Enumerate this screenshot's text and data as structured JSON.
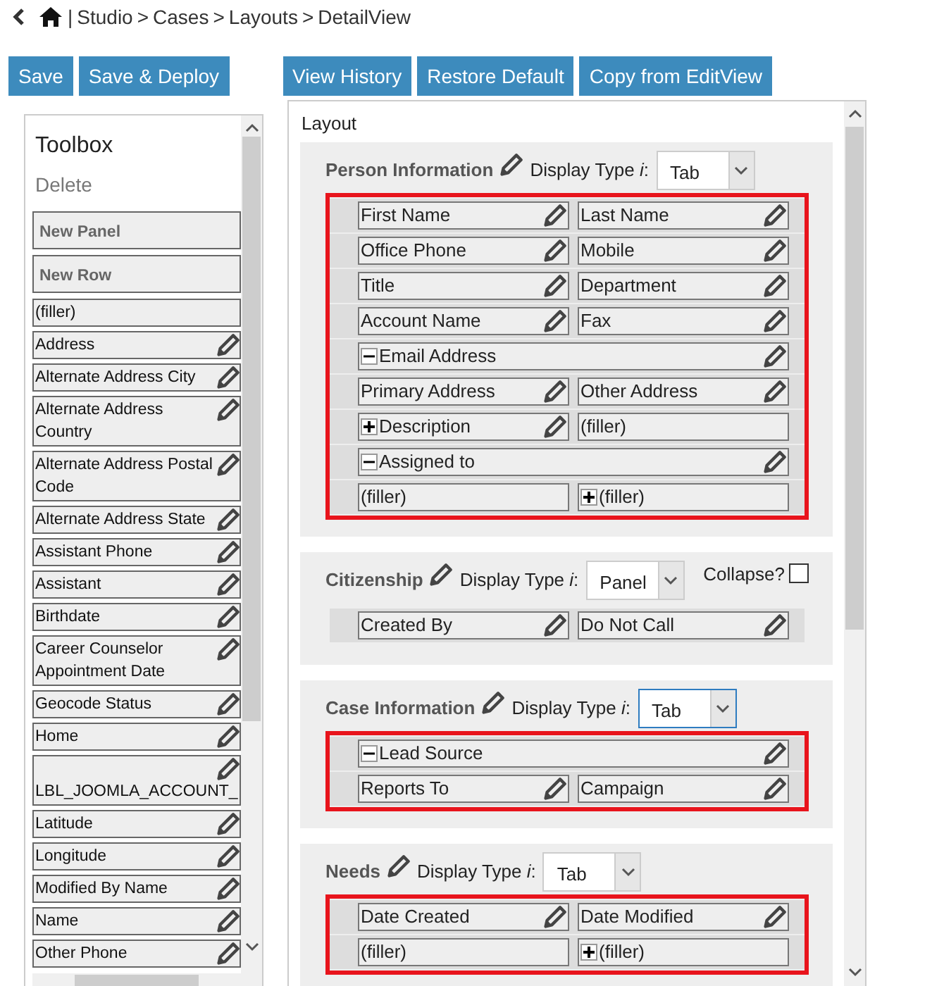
{
  "breadcrumb": {
    "divider": "|",
    "separator": ">",
    "items": [
      "Studio",
      "Cases",
      "Layouts",
      "DetailView"
    ]
  },
  "toolbar_left": [
    "Save",
    "Save & Deploy"
  ],
  "toolbar_right": [
    "View History",
    "Restore Default",
    "Copy from EditView"
  ],
  "toolbox": {
    "title": "Toolbox",
    "delete_label": "Delete",
    "items": [
      {
        "kind": "new",
        "label": "New Panel"
      },
      {
        "kind": "new",
        "label": "New Row"
      },
      {
        "kind": "field",
        "label": "(filler)",
        "editable": false
      },
      {
        "kind": "field",
        "label": "Address",
        "editable": true
      },
      {
        "kind": "field",
        "label": "Alternate Address City",
        "editable": true
      },
      {
        "kind": "field",
        "label": "Alternate Address Country",
        "editable": true
      },
      {
        "kind": "field",
        "label": "Alternate Address Postal Code",
        "editable": true
      },
      {
        "kind": "field",
        "label": "Alternate Address State",
        "editable": true
      },
      {
        "kind": "field",
        "label": "Assistant Phone",
        "editable": true
      },
      {
        "kind": "field",
        "label": "Assistant",
        "editable": true
      },
      {
        "kind": "field",
        "label": "Birthdate",
        "editable": true
      },
      {
        "kind": "field",
        "label": "Career Counselor Appointment Date",
        "editable": true
      },
      {
        "kind": "field",
        "label": "Geocode Status",
        "editable": true
      },
      {
        "kind": "field",
        "label": "Home",
        "editable": true
      },
      {
        "kind": "field",
        "label": "LBL_JOOMLA_ACCOUNT_",
        "editable": true
      },
      {
        "kind": "field",
        "label": "Latitude",
        "editable": true
      },
      {
        "kind": "field",
        "label": "Longitude",
        "editable": true
      },
      {
        "kind": "field",
        "label": "Modified By Name",
        "editable": true
      },
      {
        "kind": "field",
        "label": "Name",
        "editable": true
      },
      {
        "kind": "field",
        "label": "Other Phone",
        "editable": true
      }
    ]
  },
  "layout": {
    "title": "Layout",
    "panels": [
      {
        "title": "Person Information",
        "display_label": "Display Type *i*:",
        "display_type": "Tab",
        "select_focused": false,
        "highlighted": true,
        "rows": [
          {
            "cells": [
              {
                "label": "First Name",
                "editable": true
              },
              {
                "label": "Last Name",
                "editable": true
              }
            ]
          },
          {
            "cells": [
              {
                "label": "Office Phone",
                "editable": true
              },
              {
                "label": "Mobile",
                "editable": true
              }
            ]
          },
          {
            "cells": [
              {
                "label": "Title",
                "editable": true
              },
              {
                "label": "Department",
                "editable": true
              }
            ]
          },
          {
            "cells": [
              {
                "label": "Account Name",
                "editable": true
              },
              {
                "label": "Fax",
                "editable": true
              }
            ]
          },
          {
            "cells": [
              {
                "label": "Email Address",
                "editable": true,
                "expanded": true
              }
            ]
          },
          {
            "cells": [
              {
                "label": "Primary Address",
                "editable": true
              },
              {
                "label": "Other Address",
                "editable": true
              }
            ]
          },
          {
            "cells": [
              {
                "label": "Description",
                "editable": true,
                "expanded": false
              },
              {
                "label": "(filler)",
                "editable": false
              }
            ]
          },
          {
            "cells": [
              {
                "label": "Assigned to",
                "editable": true,
                "expanded": true
              }
            ]
          },
          {
            "cells": [
              {
                "label": "(filler)",
                "editable": false
              },
              {
                "label": "(filler)",
                "editable": false,
                "expanded": false
              }
            ]
          }
        ]
      },
      {
        "title": "Citizenship",
        "display_label": "Display Type *i*:",
        "display_type": "Panel",
        "select_focused": false,
        "highlighted": false,
        "collapse": {
          "label": "Collapse?",
          "checked": false
        },
        "rows": [
          {
            "cells": [
              {
                "label": "Created By",
                "editable": true
              },
              {
                "label": "Do Not Call",
                "editable": true
              }
            ]
          }
        ]
      },
      {
        "title": "Case Information",
        "display_label": "Display Type *i*:",
        "display_type": "Tab",
        "select_focused": true,
        "highlighted": true,
        "rows": [
          {
            "cells": [
              {
                "label": "Lead Source",
                "editable": true,
                "expanded": true
              }
            ]
          },
          {
            "cells": [
              {
                "label": "Reports To",
                "editable": true
              },
              {
                "label": "Campaign",
                "editable": true
              }
            ]
          }
        ]
      },
      {
        "title": "Needs",
        "display_label": "Display Type *i*:",
        "display_type": "Tab",
        "select_focused": false,
        "highlighted": true,
        "rows": [
          {
            "cells": [
              {
                "label": "Date Created",
                "editable": true
              },
              {
                "label": "Date Modified",
                "editable": true
              }
            ]
          },
          {
            "cells": [
              {
                "label": "(filler)",
                "editable": false
              },
              {
                "label": "(filler)",
                "editable": false,
                "expanded": false
              }
            ]
          }
        ]
      }
    ]
  }
}
